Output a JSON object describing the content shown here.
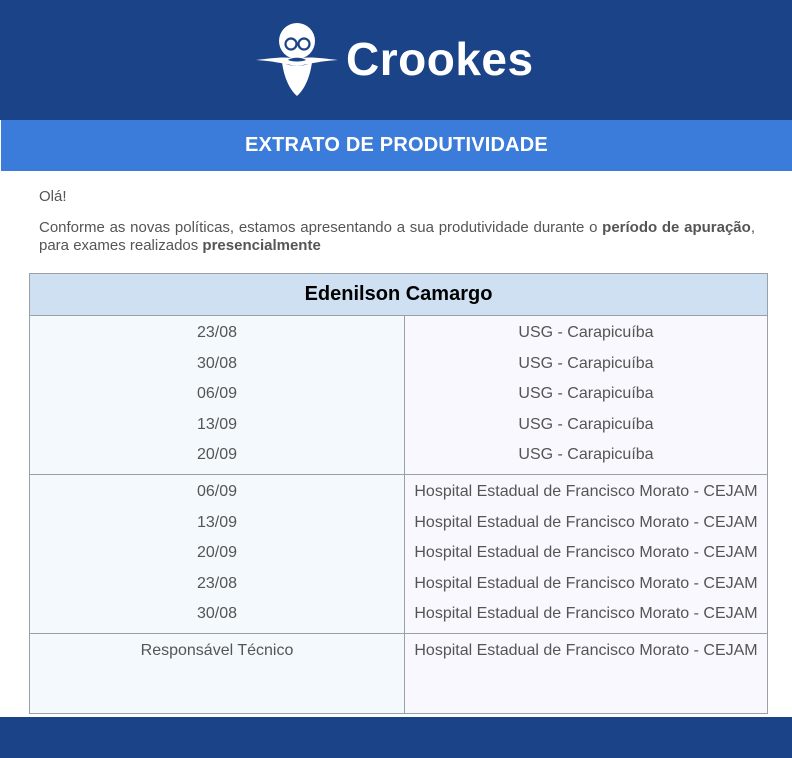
{
  "brand": {
    "name": "Crookes"
  },
  "title": "EXTRATO DE PRODUTIVIDADE",
  "greeting": "Olá!",
  "intro": {
    "part1": "Conforme as novas políticas, estamos apresentando a sua produtividade durante o ",
    "bold1": "período de apuração",
    "part2": ", para exames realizados ",
    "bold2": "presencialmente"
  },
  "table": {
    "name": "Edenilson Camargo",
    "groups": [
      {
        "left": [
          "23/08",
          "30/08",
          "06/09",
          "13/09",
          "20/09"
        ],
        "right": [
          "USG - Carapicuíba",
          "USG - Carapicuíba",
          "USG - Carapicuíba",
          "USG - Carapicuíba",
          "USG - Carapicuíba"
        ]
      },
      {
        "left": [
          "06/09",
          "13/09",
          "20/09",
          "23/08",
          "30/08"
        ],
        "right": [
          "Hospital Estadual de Francisco Morato - CEJAM",
          "Hospital Estadual de Francisco Morato - CEJAM",
          "Hospital Estadual de Francisco Morato - CEJAM",
          "Hospital Estadual de Francisco Morato - CEJAM",
          "Hospital Estadual de Francisco Morato - CEJAM"
        ]
      },
      {
        "left": [
          "Responsável Técnico"
        ],
        "right": [
          "Hospital Estadual de Francisco Morato - CEJAM"
        ]
      }
    ]
  },
  "colors": {
    "header_bg": "#1b4488",
    "title_bar_bg": "#3b7bd9",
    "table_head_bg": "#cfe0f2"
  },
  "icons": {
    "logo": "bearded-scientist-logo-icon"
  }
}
